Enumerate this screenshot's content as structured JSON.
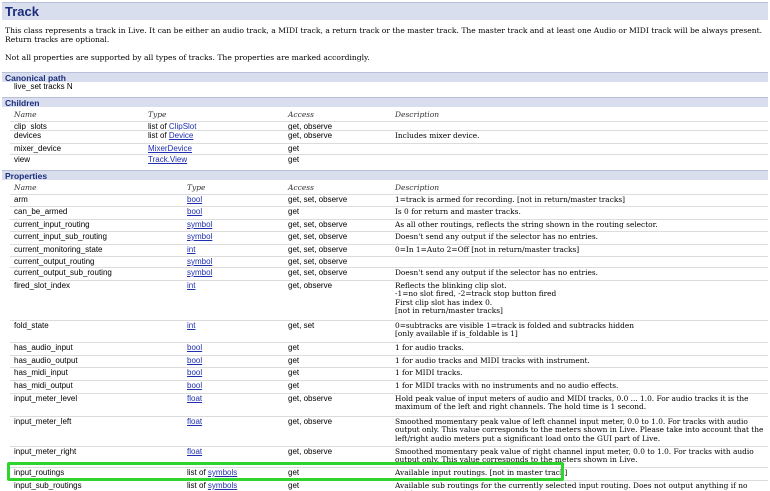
{
  "page": {
    "title": "Track",
    "intro1": "This class represents a track in Live. It can be either an audio track, a MIDI track, a return track or the master track. The master track and at least one Audio or MIDI track will be always present. Return tracks are optional.",
    "intro2": "Not all properties are supported by all types of tracks. The properties are marked accordingly."
  },
  "canonical": {
    "heading": "Canonical path",
    "path": "live_set tracks N"
  },
  "children": {
    "heading": "Children",
    "headers": {
      "name": "Name",
      "type": "Type",
      "access": "Access",
      "description": "Description"
    },
    "rows": [
      {
        "name": "clip_slots",
        "type_prefix": "list of ",
        "type": "ClipSlot",
        "access": "get, observe",
        "description": ""
      },
      {
        "name": "devices",
        "type_prefix": "list of ",
        "type": "Device",
        "access": "get, observe",
        "description": "Includes mixer device."
      },
      {
        "name": "mixer_device",
        "type_prefix": "",
        "type": "MixerDevice",
        "access": "get",
        "description": ""
      },
      {
        "name": "view",
        "type_prefix": "",
        "type": "Track.View",
        "access": "get",
        "description": ""
      }
    ]
  },
  "properties": {
    "heading": "Properties",
    "headers": {
      "name": "Name",
      "type": "Type",
      "access": "Access",
      "description": "Description"
    },
    "rows": [
      {
        "name": "arm",
        "type_prefix": "",
        "type": "bool",
        "access": "get, set, observe",
        "description": "1=track is armed for recording. [not in return/master tracks]"
      },
      {
        "name": "can_be_armed",
        "type_prefix": "",
        "type": "bool",
        "access": "get",
        "description": "Is 0 for return and master tracks."
      },
      {
        "name": "current_input_routing",
        "type_prefix": "",
        "type": "symbol",
        "access": "get, set, observe",
        "description": "As all other routings, reflects the string shown in the routing selector."
      },
      {
        "name": "current_input_sub_routing",
        "type_prefix": "",
        "type": "symbol",
        "access": "get, set, observe",
        "description": "Doesn't send any output if the selector has no entries."
      },
      {
        "name": "current_monitoring_state",
        "type_prefix": "",
        "type": "int",
        "access": "get, set, observe",
        "description": "0=In 1=Auto 2=Off [not in return/master tracks]"
      },
      {
        "name": "current_output_routing",
        "type_prefix": "",
        "type": "symbol",
        "access": "get, set, observe",
        "description": ""
      },
      {
        "name": "current_output_sub_routing",
        "type_prefix": "",
        "type": "symbol",
        "access": "get, set, observe",
        "description": "Doesn't send any output if the selector has no entries."
      },
      {
        "name": "fired_slot_index",
        "type_prefix": "",
        "type": "int",
        "access": "get, observe",
        "description": "Reflects the blinking clip slot.\n-1=no slot fired, -2=track stop button fired\nFirst clip slot has index 0.\n[not in return/master tracks]"
      },
      {
        "name": "fold_state",
        "type_prefix": "",
        "type": "int",
        "access": "get, set",
        "description": "0=subtracks are visible 1=track is folded and subtracks hidden\n[only available if is_foldable is 1]"
      },
      {
        "name": "has_audio_input",
        "type_prefix": "",
        "type": "bool",
        "access": "get",
        "description": "1 for audio tracks."
      },
      {
        "name": "has_audio_output",
        "type_prefix": "",
        "type": "bool",
        "access": "get",
        "description": "1 for audio tracks and MIDI tracks with instrument."
      },
      {
        "name": "has_midi_input",
        "type_prefix": "",
        "type": "bool",
        "access": "get",
        "description": "1 for MIDI tracks."
      },
      {
        "name": "has_midi_output",
        "type_prefix": "",
        "type": "bool",
        "access": "get",
        "description": "1 for MIDI tracks with no instruments and no audio effects."
      },
      {
        "name": "input_meter_level",
        "type_prefix": "",
        "type": "float",
        "access": "get, observe",
        "description": "Hold peak value of input meters of audio and MIDI tracks, 0.0 ... 1.0. For audio tracks it is the maximum of the left and right channels. The hold time is 1 second."
      },
      {
        "name": "input_meter_left",
        "type_prefix": "",
        "type": "float",
        "access": "get, observe",
        "description": "Smoothed momentary peak value of left channel input meter, 0.0 to 1.0. For tracks with audio output only. This value corresponds to the meters shown in Live. Please take into account that the left/right audio meters put a significant load onto the GUI part of Live."
      },
      {
        "name": "input_meter_right",
        "type_prefix": "",
        "type": "float",
        "access": "get, observe",
        "description": "Smoothed momentary peak value of right channel input meter, 0.0 to 1.0. For tracks with audio output only. This value corresponds to the meters shown in Live."
      },
      {
        "name": "input_routings",
        "type_prefix": "list of ",
        "type": "symbols",
        "access": "get",
        "description": "Available input routings. [not in master track]"
      },
      {
        "name": "input_sub_routings",
        "type_prefix": "list of ",
        "type": "symbols",
        "access": "get",
        "description": "Available sub routings for the currently selected input routing. Does not output anything if no entries are"
      }
    ]
  },
  "colors": {
    "highlight": "#2ed52e",
    "section_bg": "#d9deef",
    "link": "#1f2fb0",
    "heading": "#1b2d7a"
  }
}
